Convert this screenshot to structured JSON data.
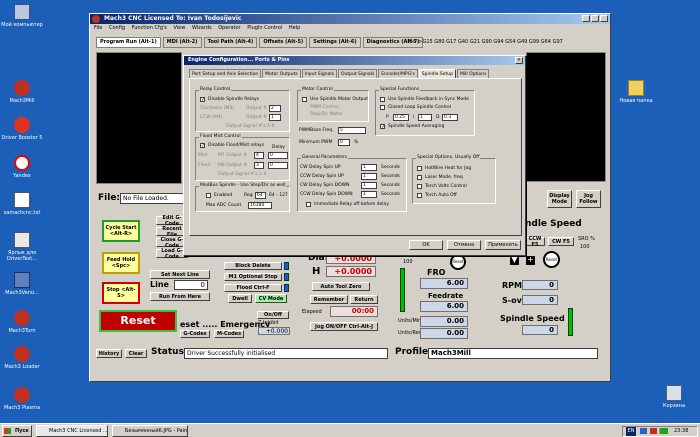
{
  "desktop": {
    "left_icons": [
      "Мой компьютер",
      "Mach3Mill",
      "Driver Booster 5",
      "Yandex",
      "samachcnc.txt",
      "Ярлык для DriverTest...",
      "Mach3Versi...",
      "Mach3Turn",
      "Mach3 Loader",
      "Mach3 Plasma"
    ],
    "right_icons": [
      "Новая папка",
      "Корзина"
    ]
  },
  "window": {
    "title": "Mach3 CNC  Licensed To: Ivan Todosijevic",
    "menu": [
      "File",
      "Config",
      "Function Cfg's",
      "View",
      "Wizards",
      "Operator",
      "PlugIn Control",
      "Help"
    ],
    "tabs": [
      "Program Run (Alt-1)",
      "MDI (Alt-2)",
      "Tool Path (Alt-4)",
      "Offsets (Alt-5)",
      "Settings (Alt-6)",
      "Diagnostics (Alt-7)"
    ],
    "gcodes": "Mill->G15  G80 G17 G40 G21 G90 G94 G54 G49 G99 G64 G97",
    "file_label": "File:",
    "file_value": "No File Loaded.",
    "buttons": {
      "edit": "Edit G-Code",
      "recent": "Recent File",
      "close": "Close G-Code",
      "load": "Load G-Code",
      "cycle_start": "Cycle Start <Alt-R>",
      "feed_hold": "Feed Hold <Spc>",
      "stop": "Stop <Alt-S>",
      "set_next": "Set Next Line",
      "run_from": "Run From Here",
      "reset": "Reset",
      "block_delete": "Block Delete",
      "optional_stop": "M1 Optional Stop",
      "flood": "Flood Ctrl-F",
      "dwell": "Dwell",
      "cv_mode": "CV Mode",
      "on_off": "On/Off",
      "auto_tool_zero": "Auto Tool Zero",
      "remember": "Remember",
      "return": "Return",
      "jog": "Jog ON/OFF Ctrl-Alt-J",
      "g_codes": "G-Codes",
      "m_codes": "M-Codes",
      "history": "History",
      "clear": "Clear",
      "display_mode": "Display Mode",
      "jog_follow": "Jog Follow",
      "ccw": "CCW F5",
      "cw": "CW F5"
    },
    "line_label": "Line",
    "line_value": "0",
    "emergency": "eset ..... Emergency",
    "inhibit": "Z Inhibit",
    "inhibit_value": "+0.000",
    "dia_label": "Dia.",
    "dia_value": "+0.0000",
    "h_label": "H",
    "h_value": "+0.0000",
    "elapsed_label": "Elapsed",
    "elapsed_value": "00:00",
    "fro_label": "FRO",
    "fro_value": "6.00",
    "feedrate_label": "Feedrate",
    "feedrate_value": "6.00",
    "units_min_label": "Units/Min",
    "units_min_value": "0.00",
    "units_rev_label": "Units/Rev",
    "units_rev_value": "0.00",
    "fro_pct": "100",
    "sro_label": "SRO %",
    "sro_value": "100",
    "rpm_label": "RPM",
    "rpm_value": "0",
    "sov_label": "S-ov",
    "sov_value": "0",
    "spindle_speed_label": "Spindle Speed",
    "spindle_speed_value": "0",
    "spindle_title": "ndle Speed",
    "status_label": "Status:",
    "status_value": "Driver Successfully initialised",
    "profile_label": "Profile:",
    "profile_value": "Mach3Mill",
    "reset_small": "Reset"
  },
  "dialog": {
    "title": "Engine Configuration... Ports & Pins",
    "tabs": [
      "Port Setup and Axis Selection",
      "Motor Outputs",
      "Input Signals",
      "Output Signals",
      "Encoder/MPG's",
      "Spindle Setup",
      "Mill Options"
    ],
    "active_tab": "Spindle Setup",
    "relay": {
      "title": "Relay Control",
      "disable": "Disable Spindle Relays",
      "clockwise": "Clockwise (M3)",
      "ccw": "CCW (M4)",
      "output": "Output #",
      "cw_val": "2",
      "ccw_val": "1",
      "note": "Output Signal #'s 1-6"
    },
    "flood": {
      "title": "Flood Mist Control",
      "disable": "Disable Flood/Mist relays",
      "delay": "Delay",
      "mist": "Mist",
      "m7": "M7 Output #",
      "m7_val": "4",
      "m7_delay": "0",
      "flood": "Flood",
      "m8": "M8 Output #",
      "m8_val": "3",
      "m8_delay": "0",
      "note": "Output Signal #'s 1-6"
    },
    "modbus": {
      "title": "ModBus Spindle - Use Step/Dir as well",
      "enabled": "Enabled",
      "reg": "Reg",
      "reg_val": "64",
      "range": "64 - 127",
      "max_adc": "Max ADC Count",
      "max_adc_val": "16380"
    },
    "motor": {
      "title": "Motor Control",
      "use_motor": "Use Spindle Motor Output",
      "pwm": "PWM Control",
      "stepdir": "Step/Dir Motor",
      "pwmbase": "PWMBase Freq.",
      "pwmbase_val": "5",
      "min_pwm": "Minimum PWM",
      "min_pwm_val": "0",
      "pct": "%"
    },
    "general": {
      "title": "General Parameters",
      "rows": [
        {
          "label": "CW Delay Spin UP",
          "value": "1",
          "unit": "Seconds"
        },
        {
          "label": "CCW Delay Spin UP",
          "value": "1",
          "unit": "Seconds"
        },
        {
          "label": "CW Delay Spin DOWN",
          "value": "1",
          "unit": "Seconds"
        },
        {
          "label": "CCW Delay Spin DOWN",
          "value": "1",
          "unit": "Seconds"
        }
      ],
      "immediate": "Immediate Relay off before delay"
    },
    "special": {
      "title": "Special Functions",
      "feedback": "Use Spindle Feedback in Sync Mode",
      "closed": "Closed Loop Spindle Control",
      "p": "P",
      "p_val": "0.25",
      "i": "I",
      "i_val": "1",
      "d": "D",
      "d_val": "0.3",
      "averaging": "Spindle Speed Averaging"
    },
    "options": {
      "title": "Special Options, Usually Off",
      "items": [
        "HotWire Heat for Jog",
        "Laser Mode. freq",
        "Torch Volts Control",
        "Torch Auto Off"
      ]
    },
    "ok": "OK",
    "cancel": "Отмена",
    "apply": "Применить"
  },
  "taskbar": {
    "start": "Пуск",
    "items": [
      "Mach3 CNC  Licensed ...",
      "Безымянный6.JPG - Paint"
    ],
    "lang": "EN",
    "time": "23:38"
  },
  "colors": {
    "desktop": "#1b5fb8",
    "led_green": "#00c000",
    "reset_red": "#c00000",
    "title_blue": "#0a246a"
  }
}
